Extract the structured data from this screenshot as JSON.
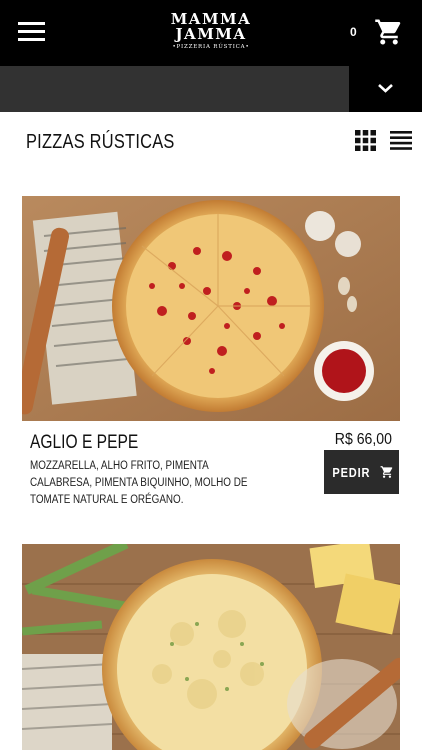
{
  "header": {
    "logo_line1": "MAMMA",
    "logo_line2": "JAMMA",
    "logo_sub": "•PIZZERIA RÚSTICA•",
    "cart_count": "0"
  },
  "section": {
    "title": "PIZZAS RÚSTICAS"
  },
  "products": [
    {
      "name": "AGLIO E PEPE",
      "price": "R$ 66,00",
      "description": "MOZZARELLA, ALHO FRITO, PIMENTA CALABRESA, PIMENTA BIQUINHO, MOLHO DE TOMATE NATURAL E ORÉGANO.",
      "order_label": "PEDIR"
    }
  ],
  "icons": {
    "menu": "hamburger-icon",
    "cart": "cart-icon",
    "chevron": "chevron-down-icon",
    "grid": "grid-view-icon",
    "list": "list-view-icon"
  },
  "colors": {
    "topbar": "#000000",
    "category_bar": "#323232",
    "order_button": "#2b2b2b"
  }
}
